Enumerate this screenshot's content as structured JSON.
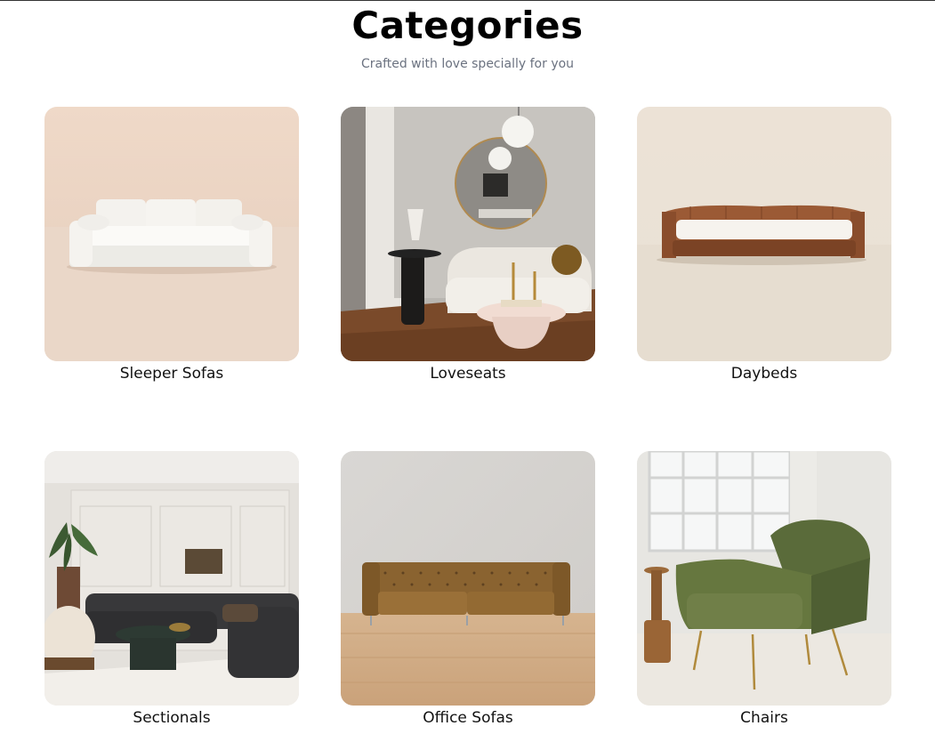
{
  "header": {
    "title": "Categories",
    "subtitle": "Crafted with love specially for you"
  },
  "categories": [
    {
      "label": "Sleeper Sofas",
      "image": "white-sleeper-sofa-photo"
    },
    {
      "label": "Loveseats",
      "image": "boucle-loveseat-room-photo"
    },
    {
      "label": "Daybeds",
      "image": "leather-daybed-photo"
    },
    {
      "label": "Sectionals",
      "image": "dark-sectional-living-room-photo"
    },
    {
      "label": "Office Sofas",
      "image": "tufted-leather-sofa-photo"
    },
    {
      "label": "Chairs",
      "image": "green-armchair-photo"
    }
  ]
}
